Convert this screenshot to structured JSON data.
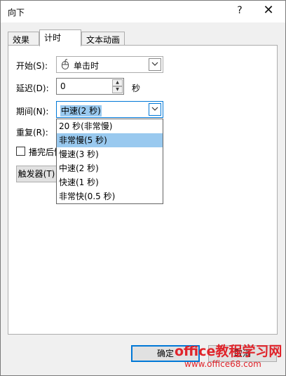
{
  "window": {
    "title": "向下",
    "help_glyph": "?",
    "close_glyph": "✕"
  },
  "tabs": [
    {
      "label": "效果",
      "active": false
    },
    {
      "label": "计时",
      "active": true
    },
    {
      "label": "文本动画",
      "active": false
    }
  ],
  "form": {
    "start_label": "开始(S):",
    "start_value": "单击时",
    "start_icon": "mouse-icon",
    "delay_label": "延迟(D):",
    "delay_value": "0",
    "delay_unit": "秒",
    "duration_label": "期间(N):",
    "duration_value": "中速(2 秒)",
    "repeat_label": "重复(R):",
    "rewind_label": "播完后快",
    "triggers_label": "触发器(T)"
  },
  "duration_options": [
    "20 秒(非常慢)",
    "非常慢(5 秒)",
    "慢速(3 秒)",
    "中速(2 秒)",
    "快速(1 秒)",
    "非常快(0.5 秒)"
  ],
  "duration_highlighted_index": 1,
  "buttons": {
    "ok": "确定",
    "cancel": "取消"
  },
  "watermark": {
    "text": "office教程学习网",
    "url": "www.office68.com"
  }
}
